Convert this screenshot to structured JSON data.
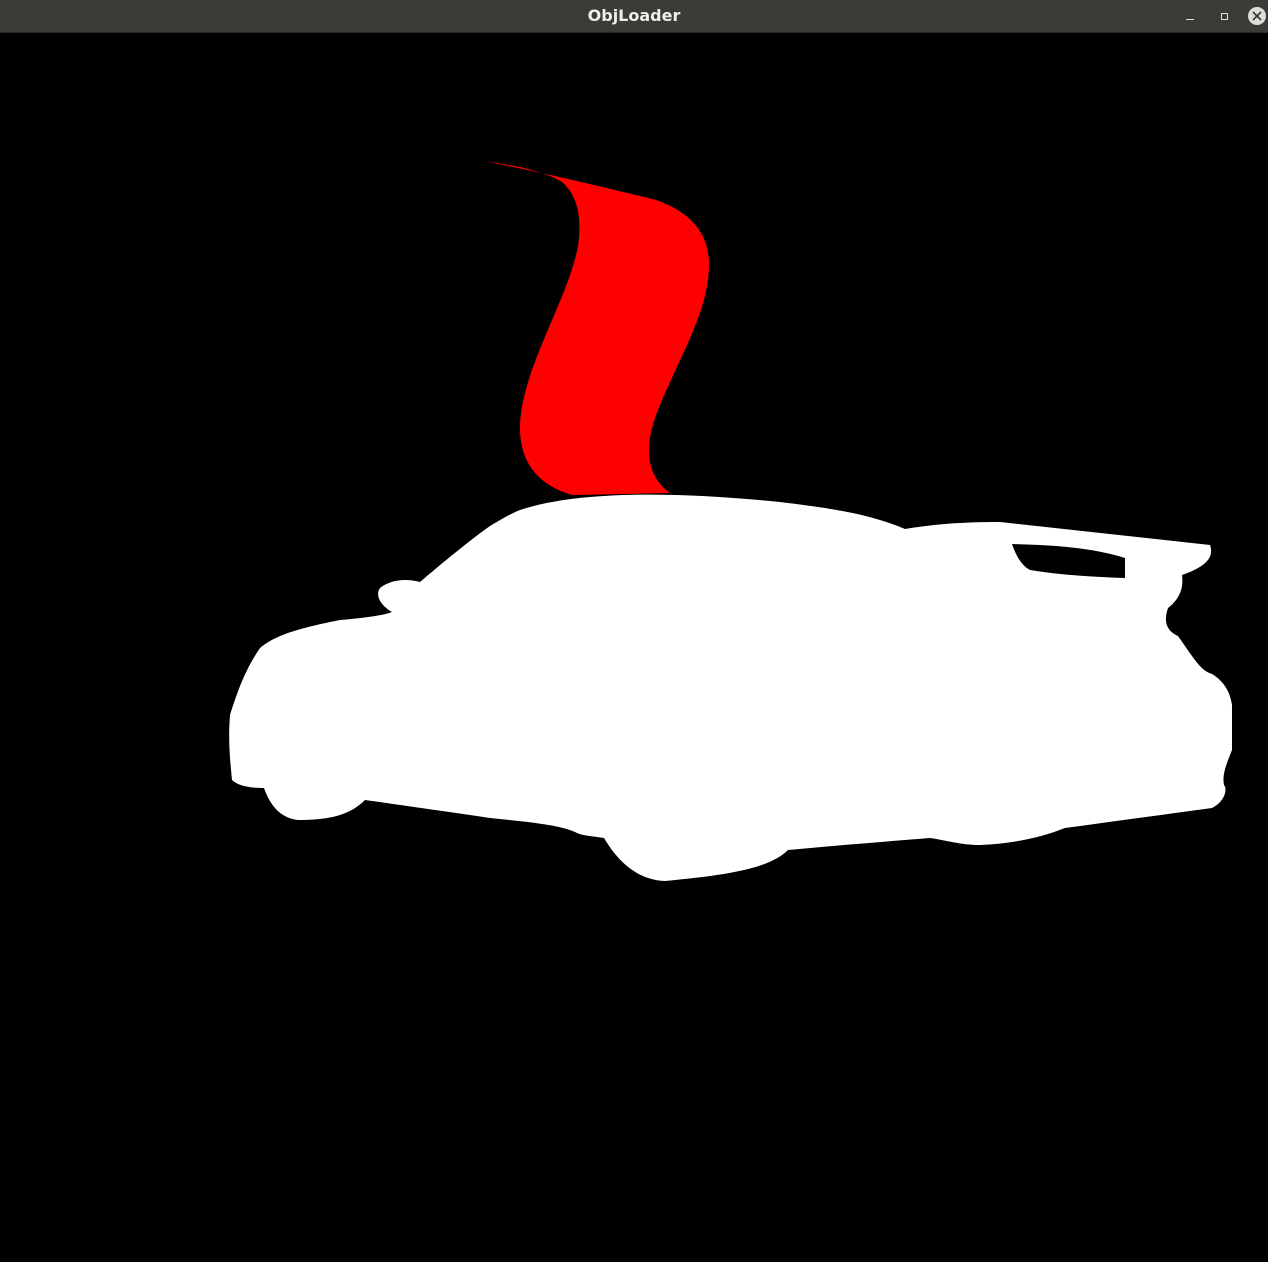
{
  "window": {
    "title": "ObjLoader",
    "controls": {
      "minimize_icon": "minimize-icon",
      "maximize_icon": "maximize-icon",
      "close_icon": "close-icon"
    }
  },
  "scene": {
    "background_color": "#000000",
    "car_color": "#ffffff",
    "ribbon_color": "#ff0000"
  }
}
